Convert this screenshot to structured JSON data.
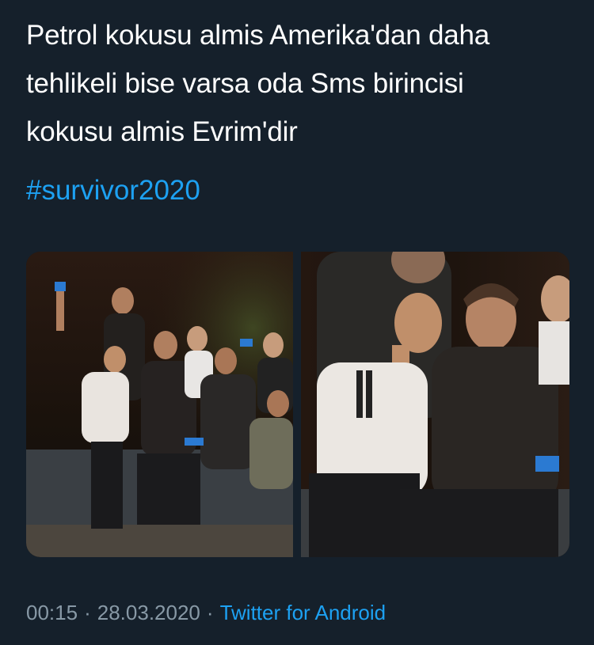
{
  "tweet": {
    "lines": [
      "Petrol kokusu almis Amerika'dan daha",
      "tehlikeli bise varsa oda Sms birincisi",
      "kokusu almis Evrim'dir"
    ],
    "hashtag": "#survivor2020"
  },
  "media": {
    "count": 2,
    "photos": [
      {
        "name": "group-photo"
      },
      {
        "name": "couple-closeup-photo"
      }
    ]
  },
  "meta": {
    "time": "00:15",
    "separator": "·",
    "date": "28.03.2020",
    "source": "Twitter for Android"
  },
  "colors": {
    "background": "#15202b",
    "text": "#ffffff",
    "link": "#1da1f2",
    "muted": "#8899a6"
  }
}
